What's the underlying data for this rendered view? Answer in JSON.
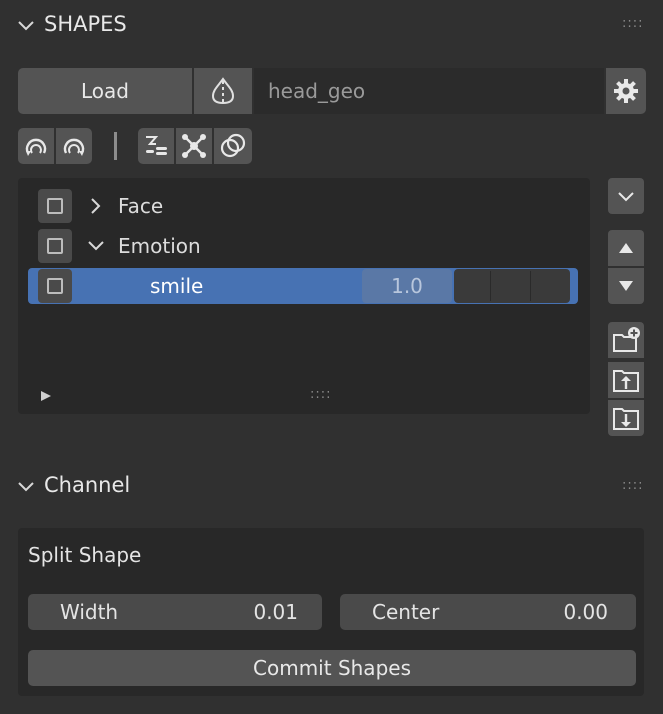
{
  "shapes_panel": {
    "title": "SHAPES",
    "load_label": "Load",
    "object_field_value": "head_geo",
    "grip": "::::"
  },
  "shape_list": {
    "rows": [
      {
        "label": "Face",
        "expanded": false,
        "checked": false
      },
      {
        "label": "Emotion",
        "expanded": true,
        "checked": false
      },
      {
        "label": "smile",
        "value": "1.0",
        "selected": true,
        "checked": false
      }
    ],
    "grip": "::::"
  },
  "channel_panel": {
    "title": "Channel",
    "grip": "::::",
    "section_title": "Split Shape",
    "width_label": "Width",
    "width_value": "0.01",
    "center_label": "Center",
    "center_value": "0.00",
    "commit_label": "Commit Shapes"
  },
  "colors": {
    "background": "#303030",
    "selected_row": "#4772b3",
    "button": "#545454",
    "list_bg": "#282828"
  }
}
